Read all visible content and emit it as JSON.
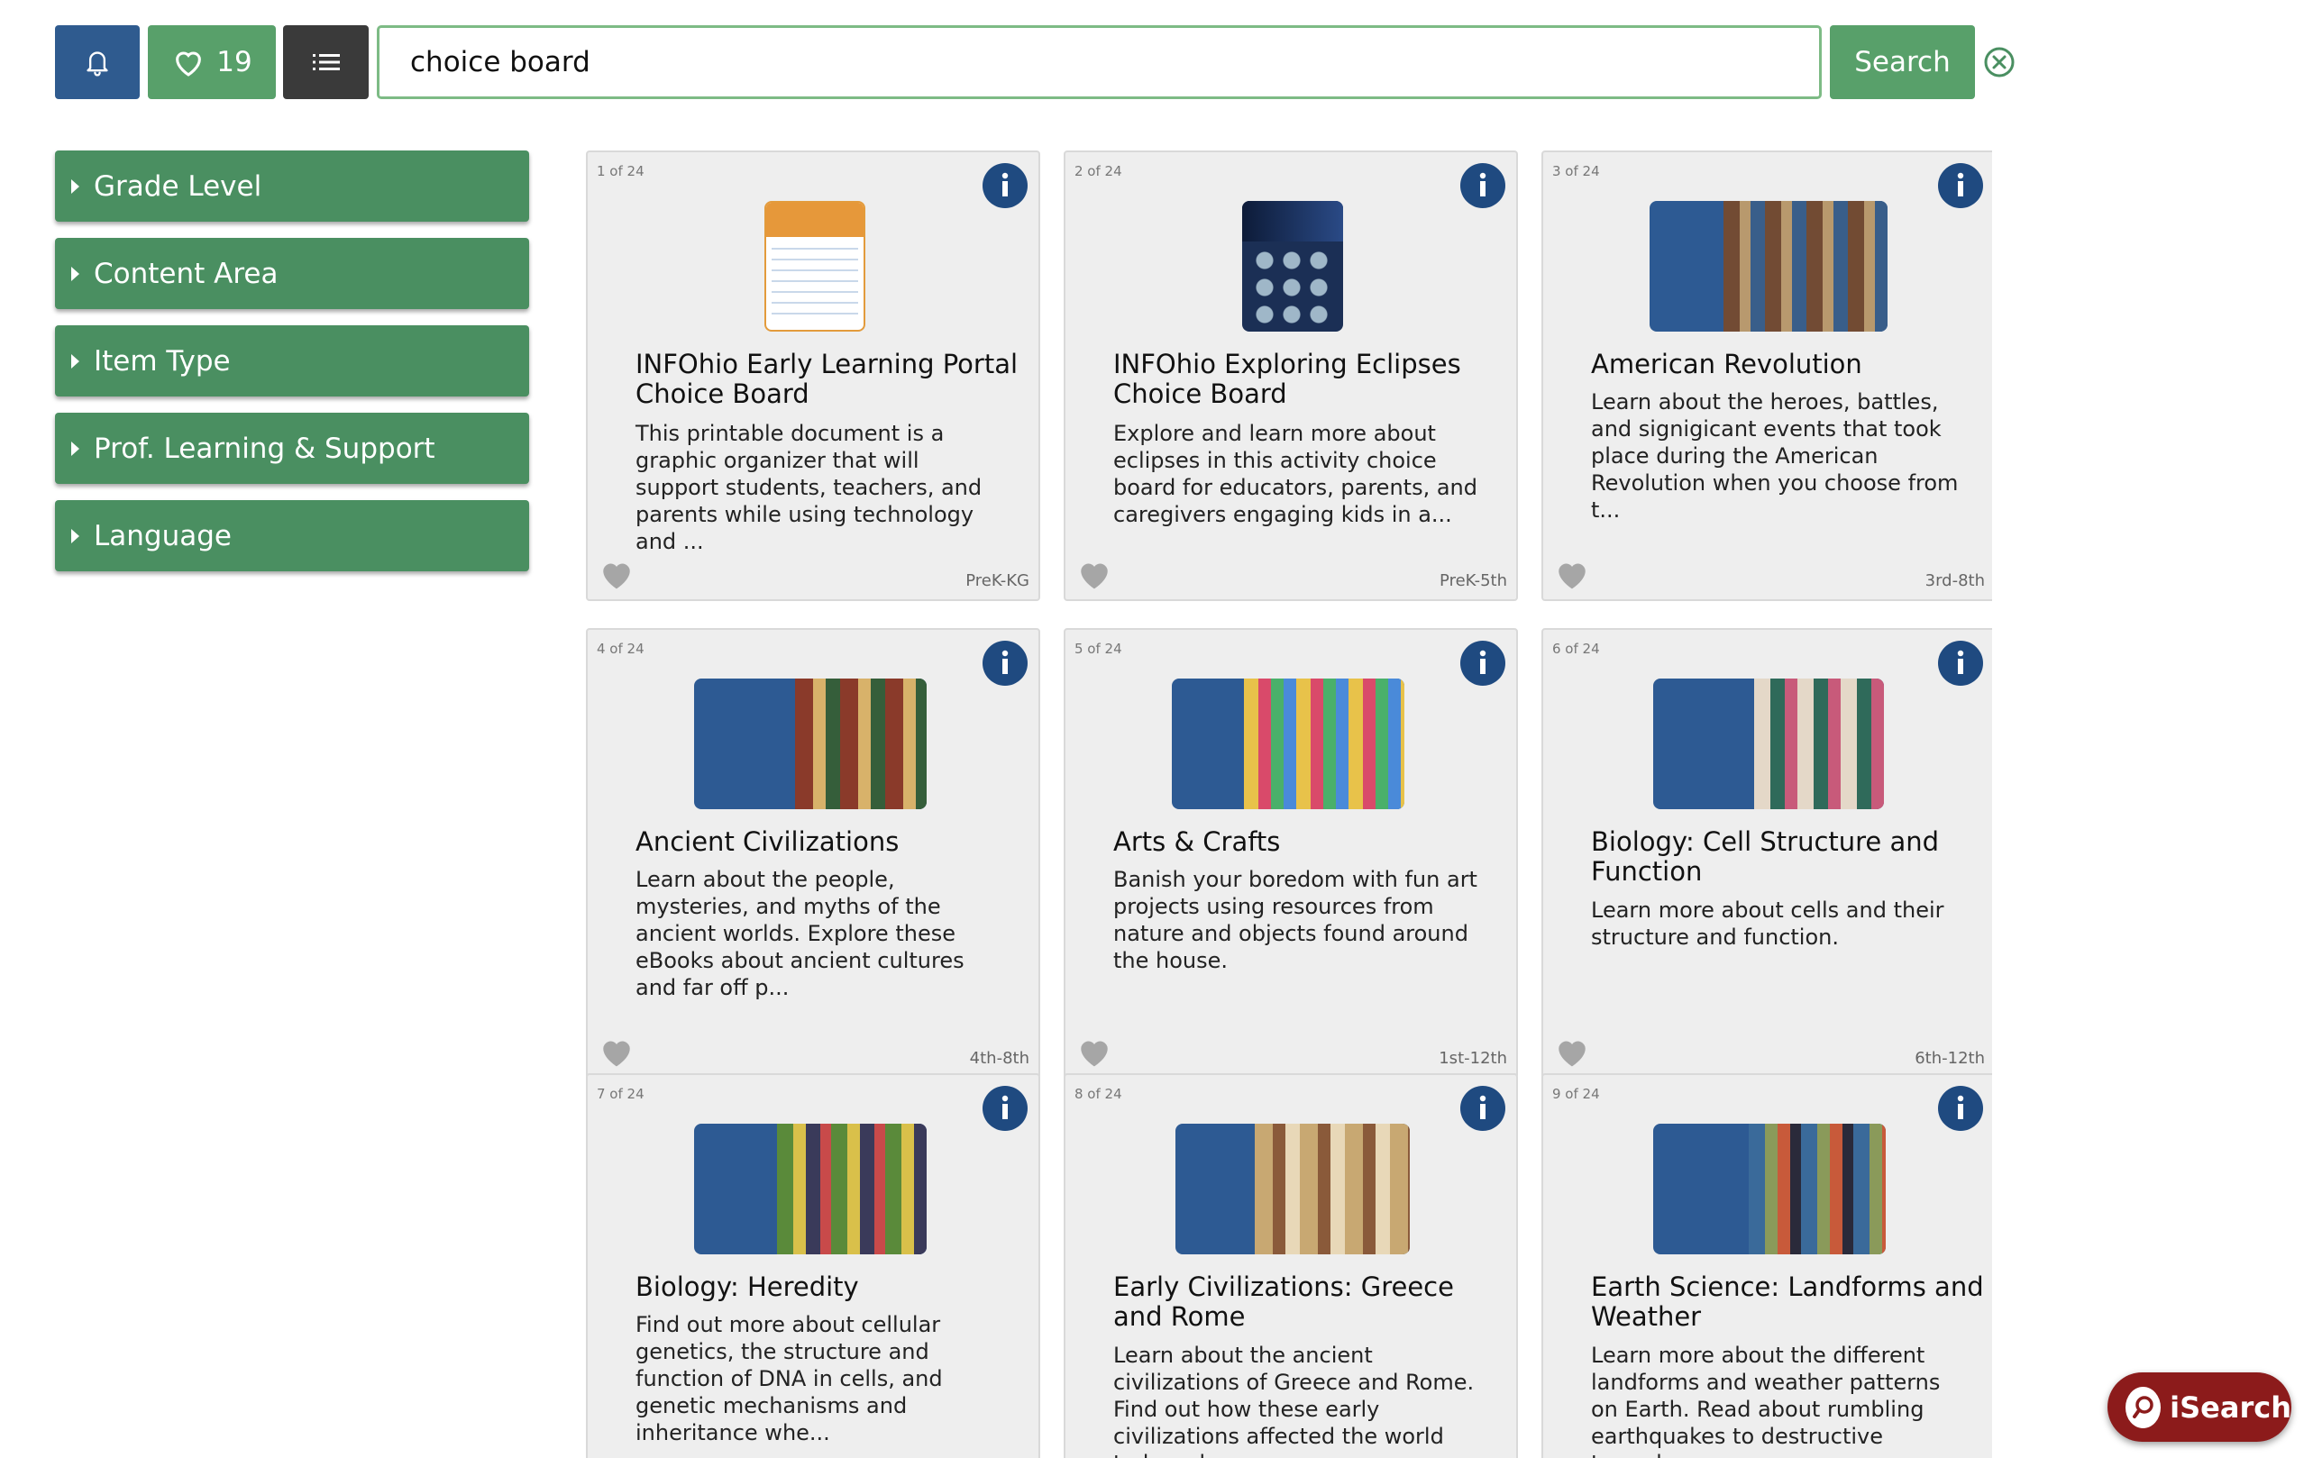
{
  "toolbar": {
    "favorites_count": "19",
    "search_value": "choice board",
    "search_label": "Search"
  },
  "sidebar": {
    "facets": [
      {
        "label": "Grade Level"
      },
      {
        "label": "Content Area"
      },
      {
        "label": "Item Type"
      },
      {
        "label": "Prof. Learning & Support"
      },
      {
        "label": "Language"
      }
    ]
  },
  "results": {
    "cards": [
      {
        "count": "1 of 24",
        "title": "INFOhio Early Learning Portal Choice Board",
        "desc": "This printable document is a graphic organizer that will support students, teachers, and parents while using technology and ...",
        "grade": "PreK-KG"
      },
      {
        "count": "2 of 24",
        "title": "INFOhio Exploring Eclipses Choice Board",
        "desc": "Explore and learn more about eclipses in this activity choice board for educators, parents, and caregivers engaging kids in a...",
        "grade": "PreK-5th"
      },
      {
        "count": "3 of 24",
        "title": "American Revolution",
        "desc": "Learn about the heroes, battles, and signigicant events that took place during the American Revolution when you choose from t...",
        "grade": "3rd-8th"
      },
      {
        "count": "4 of 24",
        "title": "Ancient Civilizations",
        "desc": "Learn about the people, mysteries, and myths of the ancient worlds. Explore these eBooks about ancient cultures and far off p...",
        "grade": "4th-8th"
      },
      {
        "count": "5 of 24",
        "title": "Arts & Crafts",
        "desc": "Banish your boredom with fun art projects using resources from nature and objects found around the house.",
        "grade": "1st-12th"
      },
      {
        "count": "6 of 24",
        "title": "Biology: Cell Structure and Function",
        "desc": "Learn more about cells and their structure and function.",
        "grade": "6th-12th"
      },
      {
        "count": "7 of 24",
        "title": "Biology: Heredity",
        "desc": "Find out more about cellular genetics, the structure and function of DNA in cells, and genetic mechanisms and inheritance whe...",
        "grade": ""
      },
      {
        "count": "8 of 24",
        "title": "Early Civilizations: Greece and Rome",
        "desc": "Learn about the ancient civilizations of Greece and Rome. Find out how these early civilizations affected the world today whe...",
        "grade": ""
      },
      {
        "count": "9 of 24",
        "title": "Earth Science: Landforms and Weather",
        "desc": "Learn more about the different landforms and weather patterns on Earth. Read about rumbling earthquakes to destructive tornad...",
        "grade": ""
      }
    ]
  },
  "isearch": {
    "label": "iSearch"
  },
  "colors": {
    "primary_green": "#4a8f61",
    "button_green": "#58a06a",
    "navy": "#2f5b8f",
    "info_navy": "#1f4a80",
    "isearch_red": "#8c1b1b"
  }
}
